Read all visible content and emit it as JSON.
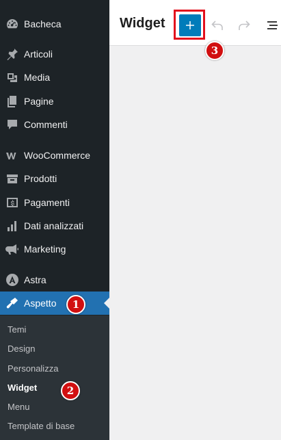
{
  "sidebar": {
    "items": [
      {
        "label": "Bacheca",
        "icon": "dashboard-icon"
      },
      {
        "label": "Articoli",
        "icon": "pin-icon"
      },
      {
        "label": "Media",
        "icon": "media-icon"
      },
      {
        "label": "Pagine",
        "icon": "pages-icon"
      },
      {
        "label": "Commenti",
        "icon": "comments-icon"
      },
      {
        "label": "WooCommerce",
        "icon": "woocommerce-icon"
      },
      {
        "label": "Prodotti",
        "icon": "products-icon"
      },
      {
        "label": "Pagamenti",
        "icon": "payments-icon"
      },
      {
        "label": "Dati analizzati",
        "icon": "analytics-icon"
      },
      {
        "label": "Marketing",
        "icon": "marketing-icon"
      },
      {
        "label": "Astra",
        "icon": "astra-icon"
      },
      {
        "label": "Aspetto",
        "icon": "appearance-icon",
        "current": true
      }
    ],
    "submenu": [
      {
        "label": "Temi"
      },
      {
        "label": "Design"
      },
      {
        "label": "Personalizza"
      },
      {
        "label": "Widget",
        "current": true
      },
      {
        "label": "Menu"
      },
      {
        "label": "Template di base"
      }
    ]
  },
  "header": {
    "title": "Widget",
    "toolbar": {
      "add_icon": "plus-icon",
      "undo_icon": "undo-icon",
      "redo_icon": "redo-icon",
      "list_view_icon": "list-view-icon"
    }
  },
  "annotations": {
    "badge_1": "1",
    "badge_2": "2",
    "badge_3": "3"
  },
  "colors": {
    "sidebar_bg": "#1d2327",
    "submenu_bg": "#2c3338",
    "accent": "#2271b1",
    "add_button": "#007cba",
    "highlight_box": "#e20f1c",
    "badge": "#d10f10"
  }
}
